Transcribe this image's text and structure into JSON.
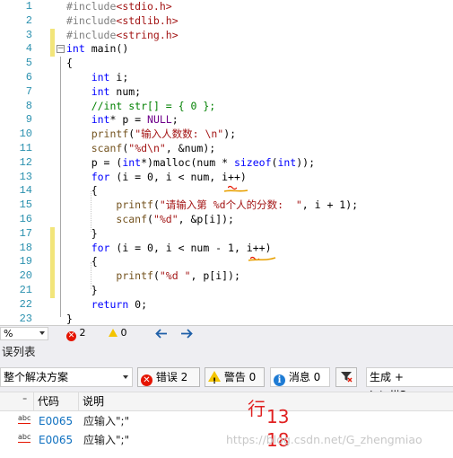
{
  "editor": {
    "line_numbers": [
      "1",
      "2",
      "3",
      "4",
      "5",
      "6",
      "7",
      "8",
      "9",
      "10",
      "11",
      "12",
      "13",
      "14",
      "15",
      "16",
      "17",
      "18",
      "19",
      "20",
      "21",
      "22",
      "23"
    ],
    "lines": [
      [
        {
          "t": "#include",
          "c": "pp"
        },
        {
          "t": "<stdio.h>",
          "c": "str"
        }
      ],
      [
        {
          "t": "#include",
          "c": "pp"
        },
        {
          "t": "<stdlib.h>",
          "c": "str"
        }
      ],
      [
        {
          "t": "#include",
          "c": "pp"
        },
        {
          "t": "<string.h>",
          "c": "str"
        }
      ],
      [
        {
          "t": "int",
          "c": "kw"
        },
        {
          "t": " main()",
          "c": ""
        }
      ],
      [
        {
          "t": "{",
          "c": ""
        }
      ],
      [
        {
          "t": "    ",
          "c": ""
        },
        {
          "t": "int",
          "c": "kw"
        },
        {
          "t": " i;",
          "c": ""
        }
      ],
      [
        {
          "t": "    ",
          "c": ""
        },
        {
          "t": "int",
          "c": "kw"
        },
        {
          "t": " num;",
          "c": ""
        }
      ],
      [
        {
          "t": "    ",
          "c": ""
        },
        {
          "t": "//int str[] = { 0 };",
          "c": "cm"
        }
      ],
      [
        {
          "t": "    ",
          "c": ""
        },
        {
          "t": "int",
          "c": "kw"
        },
        {
          "t": "* p = ",
          "c": ""
        },
        {
          "t": "NULL",
          "c": "mac"
        },
        {
          "t": ";",
          "c": ""
        }
      ],
      [
        {
          "t": "    ",
          "c": ""
        },
        {
          "t": "printf",
          "c": "fn"
        },
        {
          "t": "(",
          "c": ""
        },
        {
          "t": "\"输入人数数: \\n\"",
          "c": "str"
        },
        {
          "t": ");",
          "c": ""
        }
      ],
      [
        {
          "t": "    ",
          "c": ""
        },
        {
          "t": "scanf",
          "c": "fn"
        },
        {
          "t": "(",
          "c": ""
        },
        {
          "t": "\"%d\\n\"",
          "c": "str"
        },
        {
          "t": ", &num);",
          "c": ""
        }
      ],
      [
        {
          "t": "    p = (",
          "c": ""
        },
        {
          "t": "int",
          "c": "kw"
        },
        {
          "t": "*)malloc(num * ",
          "c": ""
        },
        {
          "t": "sizeof",
          "c": "kw"
        },
        {
          "t": "(",
          "c": ""
        },
        {
          "t": "int",
          "c": "kw"
        },
        {
          "t": "));",
          "c": ""
        }
      ],
      [
        {
          "t": "    ",
          "c": ""
        },
        {
          "t": "for",
          "c": "kw"
        },
        {
          "t": " (i = 0, i < num, i++)",
          "c": ""
        }
      ],
      [
        {
          "t": "    {",
          "c": ""
        }
      ],
      [
        {
          "t": "        ",
          "c": ""
        },
        {
          "t": "printf",
          "c": "fn"
        },
        {
          "t": "(",
          "c": ""
        },
        {
          "t": "\"请输入第 %d个人的分数:  \"",
          "c": "str"
        },
        {
          "t": ", i + 1);",
          "c": ""
        }
      ],
      [
        {
          "t": "        ",
          "c": ""
        },
        {
          "t": "scanf",
          "c": "fn"
        },
        {
          "t": "(",
          "c": ""
        },
        {
          "t": "\"%d\"",
          "c": "str"
        },
        {
          "t": ", &p[i]);",
          "c": ""
        }
      ],
      [
        {
          "t": "    }",
          "c": ""
        }
      ],
      [
        {
          "t": "    ",
          "c": ""
        },
        {
          "t": "for",
          "c": "kw"
        },
        {
          "t": " (i = 0, i < num - 1, i++)",
          "c": ""
        }
      ],
      [
        {
          "t": "    {",
          "c": ""
        }
      ],
      [
        {
          "t": "        ",
          "c": ""
        },
        {
          "t": "printf",
          "c": "fn"
        },
        {
          "t": "(",
          "c": ""
        },
        {
          "t": "\"%d \"",
          "c": "str"
        },
        {
          "t": ", p[i]);",
          "c": ""
        }
      ],
      [
        {
          "t": "    }",
          "c": ""
        }
      ],
      [
        {
          "t": "    ",
          "c": ""
        },
        {
          "t": "return",
          "c": "kw"
        },
        {
          "t": " 0;",
          "c": ""
        }
      ],
      [
        {
          "t": "}",
          "c": ""
        }
      ]
    ],
    "colors": {
      "keyword": "#0000ff",
      "preprocessor": "#808080",
      "string": "#a31515",
      "comment": "#008000",
      "line_number": "#2b91af",
      "change_bar": "#f2e57a",
      "squiggle": "#e51400"
    }
  },
  "editor_status": {
    "zoom": "%",
    "error_count": "2",
    "warning_count": "0",
    "back_icon": "arrow-left-icon",
    "forward_icon": "arrow-right-icon"
  },
  "error_list": {
    "title": "误列表",
    "scope": "整个解决方案",
    "errors_label": "错误 2",
    "warnings_label": "警告 0",
    "messages_label": "消息 0",
    "build_filter": "生成 + IntelliSen",
    "columns": {
      "code": "代码",
      "description": "说明"
    },
    "rows": [
      {
        "code": "E0065",
        "description": "应输入\";\"",
        "type_icon": "abc"
      },
      {
        "code": "E0065",
        "description": "应输入\";\"",
        "type_icon": "abc"
      }
    ]
  },
  "annotations": {
    "row_label": "行",
    "line_a": "13",
    "line_b": "18"
  },
  "watermark": "https://blog.csdn.net/G_zhengmiao"
}
